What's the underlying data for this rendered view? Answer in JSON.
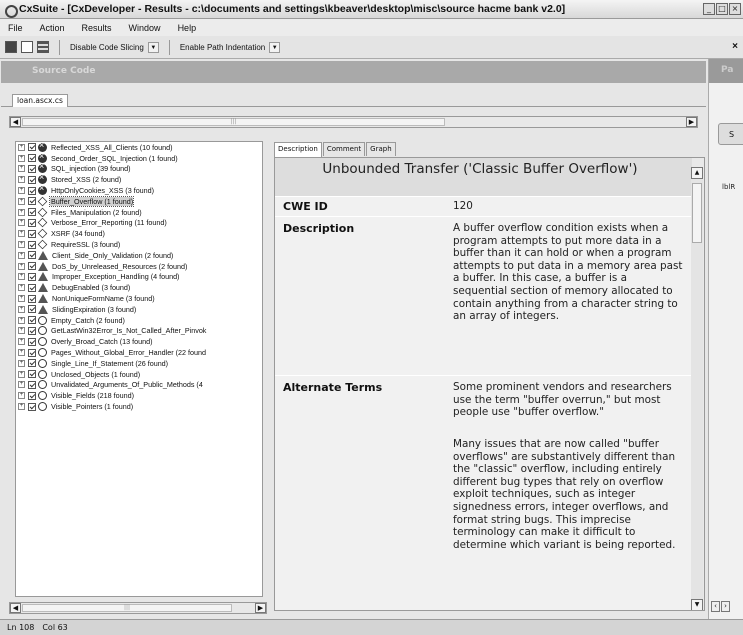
{
  "window": {
    "title": "CxSuite - [CxDeveloper - Results - c:\\documents and settings\\kbeaver\\desktop\\misc\\source hacme bank v2.0]"
  },
  "menu": [
    "File",
    "Action",
    "Results",
    "Window",
    "Help"
  ],
  "toolbar": {
    "code_slicing": "Disable Code Slicing",
    "path_indentation": "Enable Path Indentation",
    "close_label": "×"
  },
  "source_panel": {
    "header": "Source Code"
  },
  "file_tab": "loan.ascx.cs",
  "right_panel": {
    "header": "Pa",
    "button_label": "S",
    "label": "lblR"
  },
  "results_tree": [
    {
      "label": "Reflected_XSS_All_Clients (10 found)",
      "severity": "high"
    },
    {
      "label": "Second_Order_SQL_Injection (1 found)",
      "severity": "high"
    },
    {
      "label": "SQL_injection (39 found)",
      "severity": "high"
    },
    {
      "label": "Stored_XSS (2 found)",
      "severity": "high"
    },
    {
      "label": "HttpOnlyCookies_XSS (3 found)",
      "severity": "high"
    },
    {
      "label": "Buffer_Overflow (1 found)",
      "severity": "medium",
      "selected": true
    },
    {
      "label": "Files_Manipulation (2 found)",
      "severity": "medium"
    },
    {
      "label": "Verbose_Error_Reporting (11 found)",
      "severity": "medium"
    },
    {
      "label": "XSRF (34 found)",
      "severity": "medium"
    },
    {
      "label": "RequireSSL (3 found)",
      "severity": "medium"
    },
    {
      "label": "Client_Side_Only_Validation (2 found)",
      "severity": "low"
    },
    {
      "label": "DoS_by_Unreleased_Resources (2 found)",
      "severity": "low"
    },
    {
      "label": "Improper_Exception_Handling (4 found)",
      "severity": "low"
    },
    {
      "label": "DebugEnabled (3 found)",
      "severity": "low"
    },
    {
      "label": "NonUniqueFormName (3 found)",
      "severity": "low"
    },
    {
      "label": "SlidingExpiration (3 found)",
      "severity": "low"
    },
    {
      "label": "Empty_Catch (2 found)",
      "severity": "info"
    },
    {
      "label": "GetLastWin32Error_Is_Not_Called_After_Pinvok",
      "severity": "info"
    },
    {
      "label": "Overly_Broad_Catch (13 found)",
      "severity": "info"
    },
    {
      "label": "Pages_Without_Global_Error_Handler (22 found",
      "severity": "info"
    },
    {
      "label": "Single_Line_If_Statement (26 found)",
      "severity": "info"
    },
    {
      "label": "Unclosed_Objects (1 found)",
      "severity": "info"
    },
    {
      "label": "Unvalidated_Arguments_Of_Public_Methods (4",
      "severity": "info"
    },
    {
      "label": "Visible_Fields (218 found)",
      "severity": "info"
    },
    {
      "label": "Visible_Pointers (1 found)",
      "severity": "info"
    }
  ],
  "desc_tabs": [
    "Description",
    "Comment",
    "Graph"
  ],
  "description": {
    "title": "Unbounded Transfer ('Classic Buffer Overflow')",
    "cwe_label": "CWE ID",
    "cwe_value": "120",
    "desc_label": "Description",
    "desc_text": "A buffer overflow condition exists when a program attempts to put more data in a buffer than it can hold or when a program attempts to put data in a memory area past a buffer. In this case, a buffer is a sequential section of memory allocated to contain anything from a character string to an array of integers.",
    "alt_label": "Alternate Terms",
    "alt_text_1": "Some prominent vendors and researchers use the term \"buffer overrun,\" but most people use \"buffer overflow.\"",
    "alt_text_2": "Many issues that are now called \"buffer overflows\" are substantively different than the \"classic\" overflow, including entirely different bug types that rely on overflow exploit techniques, such as integer signedness errors, integer overflows, and format string bugs. This imprecise terminology can make it difficult to determine which variant is being reported."
  },
  "status": {
    "line": "Ln 108",
    "col": "Col 63"
  }
}
